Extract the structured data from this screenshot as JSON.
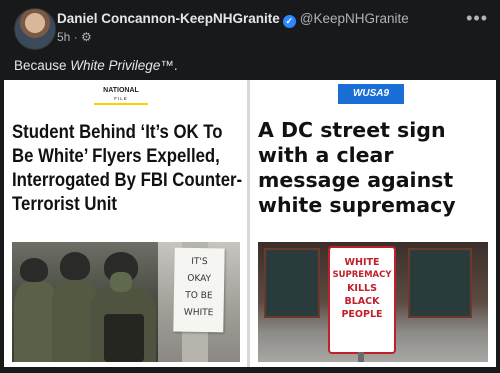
{
  "post": {
    "author_name": "Daniel Concannon-KeepNHGranite",
    "handle": "@KeepNHGranite",
    "time": "5h",
    "caption_prefix": "Because ",
    "caption_emphasis": "White Privilege™",
    "caption_suffix": "."
  },
  "left_panel": {
    "logo_text": "NATIONAL",
    "logo_sub": "FILE",
    "headline": "Student Behind ‘It’s OK To Be White’ Flyers Expelled, Interrogated By FBI Counter-Terrorist Unit",
    "sign_lines": [
      "IT'S",
      "OKAY",
      "TO BE",
      "WHITE"
    ]
  },
  "right_panel": {
    "logo_text": "WUSA9",
    "headline": "A DC street sign with a clear message against white supremacy",
    "sign_lines": [
      "WHITE",
      "SUPREMACY",
      "KILLS",
      "BLACK",
      "PEOPLE"
    ]
  },
  "colors": {
    "background": "#18191a",
    "verified": "#2d88ff",
    "wusa_blue": "#1a6fd6",
    "sign_red": "#c0202a",
    "ng_yellow": "#ffcf00"
  }
}
